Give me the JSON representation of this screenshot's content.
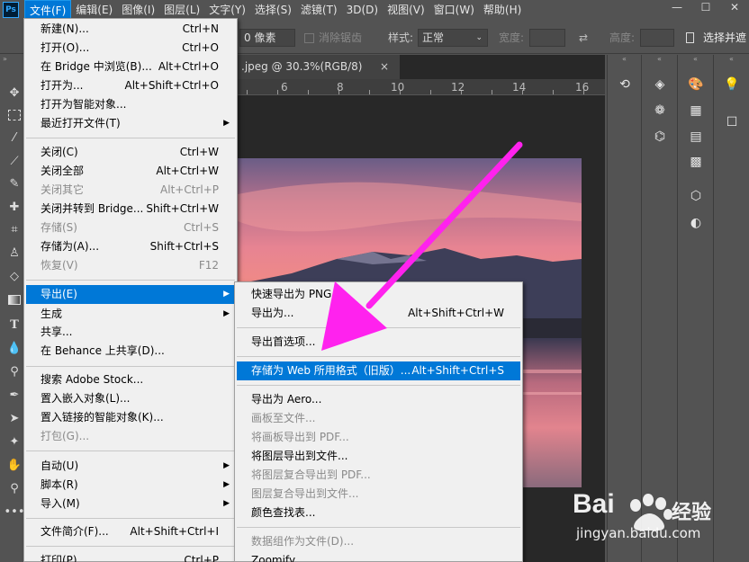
{
  "app": {
    "logo": "Ps"
  },
  "menubar": [
    {
      "label": "文件(F)",
      "active": true
    },
    {
      "label": "编辑(E)"
    },
    {
      "label": "图像(I)"
    },
    {
      "label": "图层(L)"
    },
    {
      "label": "文字(Y)"
    },
    {
      "label": "选择(S)"
    },
    {
      "label": "滤镜(T)"
    },
    {
      "label": "3D(D)"
    },
    {
      "label": "视图(V)"
    },
    {
      "label": "窗口(W)"
    },
    {
      "label": "帮助(H)"
    }
  ],
  "window_controls": {
    "minimize": "—",
    "maximize": "☐",
    "close": "✕"
  },
  "options": {
    "feather_value": "0 像素",
    "antialias_label": "消除锯齿",
    "style_label": "样式:",
    "style_value": "正常",
    "width_label": "宽度:",
    "height_label": "高度:",
    "select_mask_label": "选择并遮"
  },
  "document": {
    "tab_title": ".jpeg @ 30.3%(RGB/8)",
    "tab_close": "×",
    "ruler_labels": [
      "6",
      "8",
      "10",
      "12",
      "14",
      "16"
    ]
  },
  "file_menu": {
    "items": [
      {
        "label": "新建(N)...",
        "shortcut": "Ctrl+N"
      },
      {
        "label": "打开(O)...",
        "shortcut": "Ctrl+O"
      },
      {
        "label": "在 Bridge 中浏览(B)...",
        "shortcut": "Alt+Ctrl+O"
      },
      {
        "label": "打开为...",
        "shortcut": "Alt+Shift+Ctrl+O"
      },
      {
        "label": "打开为智能对象..."
      },
      {
        "label": "最近打开文件(T)",
        "submenu": true
      },
      {
        "label": "关闭(C)",
        "shortcut": "Ctrl+W"
      },
      {
        "label": "关闭全部",
        "shortcut": "Alt+Ctrl+W"
      },
      {
        "label": "关闭其它",
        "shortcut": "Alt+Ctrl+P",
        "disabled": true
      },
      {
        "label": "关闭并转到 Bridge...",
        "shortcut": "Shift+Ctrl+W"
      },
      {
        "label": "存储(S)",
        "shortcut": "Ctrl+S",
        "disabled": true
      },
      {
        "label": "存储为(A)...",
        "shortcut": "Shift+Ctrl+S"
      },
      {
        "label": "恢复(V)",
        "shortcut": "F12",
        "disabled": true
      },
      {
        "label": "导出(E)",
        "submenu": true,
        "highlighted": true
      },
      {
        "label": "生成",
        "submenu": true
      },
      {
        "label": "共享..."
      },
      {
        "label": "在 Behance 上共享(D)..."
      },
      {
        "label": "搜索 Adobe Stock..."
      },
      {
        "label": "置入嵌入对象(L)..."
      },
      {
        "label": "置入链接的智能对象(K)..."
      },
      {
        "label": "打包(G)...",
        "disabled": true
      },
      {
        "label": "自动(U)",
        "submenu": true
      },
      {
        "label": "脚本(R)",
        "submenu": true
      },
      {
        "label": "导入(M)",
        "submenu": true
      },
      {
        "label": "文件简介(F)...",
        "shortcut": "Alt+Shift+Ctrl+I"
      },
      {
        "label": "打印(P)...",
        "shortcut": "Ctrl+P"
      }
    ]
  },
  "export_menu": {
    "items": [
      {
        "label": "快速导出为 PNG"
      },
      {
        "label": "导出为...",
        "shortcut": "Alt+Shift+Ctrl+W"
      },
      {
        "label": "导出首选项..."
      },
      {
        "label": "存储为 Web 所用格式（旧版）...",
        "shortcut": "Alt+Shift+Ctrl+S",
        "highlighted": true
      },
      {
        "label": "导出为 Aero..."
      },
      {
        "label": "画板至文件...",
        "disabled": true
      },
      {
        "label": "将画板导出到 PDF...",
        "disabled": true
      },
      {
        "label": "将图层导出到文件..."
      },
      {
        "label": "将图层复合导出到 PDF...",
        "disabled": true
      },
      {
        "label": "图层复合导出到文件...",
        "disabled": true
      },
      {
        "label": "颜色查找表..."
      },
      {
        "label": "数据组作为文件(D)...",
        "disabled": true
      },
      {
        "label": "Zoomify..."
      }
    ]
  },
  "watermark": {
    "brand": "Bai",
    "brand_cn": "经验",
    "url": "jingyan.baidu.com"
  },
  "colors": {
    "highlight": "#0078d7",
    "arrow": "#ff22ee",
    "bg": "#535353",
    "menu_bg": "#f0f0f0"
  }
}
